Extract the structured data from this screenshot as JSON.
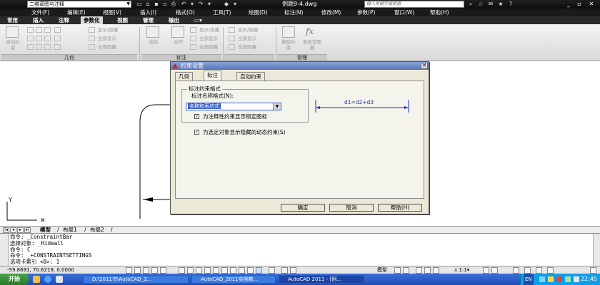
{
  "titlebar": {
    "workspace": "二维草图与注释",
    "doc_title": "例题9-4.dwg",
    "search_placeholder": "键入关键字或短语"
  },
  "menubar": [
    "文件(F)",
    "编辑(E)",
    "视图(V)",
    "插入(I)",
    "格式(O)",
    "工具(T)",
    "绘图(D)",
    "标注(N)",
    "修改(M)",
    "参数(P)",
    "窗口(W)",
    "帮助(H)"
  ],
  "ribbon_tabs": [
    "常用",
    "插入",
    "注释",
    "参数化",
    "视图",
    "管理",
    "输出"
  ],
  "active_ribbon_tab": "参数化",
  "ribbon": {
    "geometry": {
      "label": "几何",
      "auto_label": "自动约束",
      "items": [
        "显示/隐藏",
        "全部显示",
        "全部隐藏"
      ]
    },
    "dimension": {
      "label": "标注",
      "linear": "线性",
      "aligned": "对齐",
      "items": [
        "显示/隐藏",
        "全部显示",
        "全部隐藏"
      ]
    },
    "dim_extra": {
      "items": [
        "显示/隐藏",
        "全部显示",
        "全部隐藏"
      ]
    },
    "manage": {
      "label": "管理",
      "delete": "删除约束",
      "params": "参数管理器"
    }
  },
  "layout_tabs": [
    "模型",
    "布局1",
    "布局2"
  ],
  "command_lines": [
    "命令: _ConstraintBar",
    "选择对象: _Hideall",
    "命令: C",
    "命令: _+CONSTRAINTSETTINGS",
    "选项卡索引 <0>: 1"
  ],
  "statusbar": {
    "coords": "-59.8691, 70.6219, 0.0000",
    "model": "模型",
    "scale": "1:1"
  },
  "taskbar": {
    "start": "开始",
    "tasks": [
      "D:\\2011书\\AutoCAD_2...",
      "AutoCAD_2011实例教...",
      "AutoCAD 2011 - [例..."
    ],
    "ime": "EN",
    "time": "22:45"
  },
  "dialog": {
    "title": "约束设置",
    "tabs": [
      "几何",
      "标注",
      "自动约束"
    ],
    "active_tab": "标注",
    "group_title": "标注约束格式",
    "format_label": "标注名称格式(N):",
    "format_value": "名称和表达式",
    "checkbox1": "为注释性约束显示锁定图标",
    "checkbox1_checked": true,
    "checkbox2": "为选定对象显示隐藏的动态约束(S)",
    "checkbox2_checked": true,
    "preview_text": "d1=d2+d3",
    "ok": "确定",
    "cancel": "取消",
    "help": "帮助(H)"
  }
}
